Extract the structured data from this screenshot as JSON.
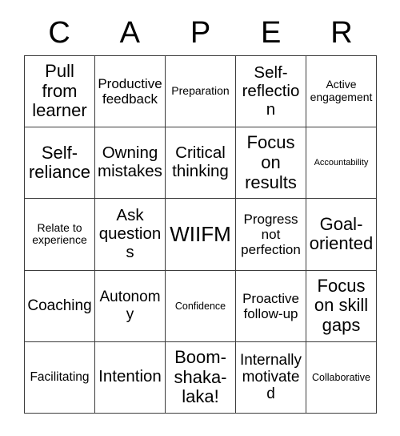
{
  "card": {
    "name": "CAPER bingo card",
    "header_letters": [
      "C",
      "A",
      "P",
      "E",
      "R"
    ],
    "columns": 5,
    "rows": 5,
    "colors": {
      "background": "#ffffff",
      "border": "#3c3c3c",
      "text": "#000000"
    },
    "cells": [
      [
        {
          "text": "Pull from learner",
          "size": "fs-xxl"
        },
        {
          "text": "Productive feedback",
          "size": "fs-ml"
        },
        {
          "text": "Preparation",
          "size": "fs-sm"
        },
        {
          "text": "Self-reflection",
          "size": "fs-xl"
        },
        {
          "text": "Active engagement",
          "size": "fs-sm"
        }
      ],
      [
        {
          "text": "Self-reliance",
          "size": "fs-xxl"
        },
        {
          "text": "Owning mistakes",
          "size": "fs-xl"
        },
        {
          "text": "Critical thinking",
          "size": "fs-xl"
        },
        {
          "text": "Focus on results",
          "size": "fs-xxl"
        },
        {
          "text": "Accountability",
          "size": "fs-xs"
        }
      ],
      [
        {
          "text": "Relate to experience",
          "size": "fs-sm"
        },
        {
          "text": "Ask questions",
          "size": "fs-xl"
        },
        {
          "text": "WIIFM",
          "size": "fs-huge"
        },
        {
          "text": "Progress not perfection",
          "size": "fs-ml"
        },
        {
          "text": "Goal-oriented",
          "size": "fs-xxl"
        }
      ],
      [
        {
          "text": "Coaching",
          "size": "fs-l"
        },
        {
          "text": "Autonomy",
          "size": "fs-l"
        },
        {
          "text": "Confidence",
          "size": "fs-s"
        },
        {
          "text": "Proactive follow-up",
          "size": "fs-ml"
        },
        {
          "text": "Focus on skill gaps",
          "size": "fs-xxl"
        }
      ],
      [
        {
          "text": "Facilitating",
          "size": "fs-m"
        },
        {
          "text": "Intention",
          "size": "fs-xl"
        },
        {
          "text": "Boom-shaka-laka!",
          "size": "fs-xxl"
        },
        {
          "text": "Internally motivated",
          "size": "fs-l"
        },
        {
          "text": "Collaborative",
          "size": "fs-s"
        }
      ]
    ]
  }
}
